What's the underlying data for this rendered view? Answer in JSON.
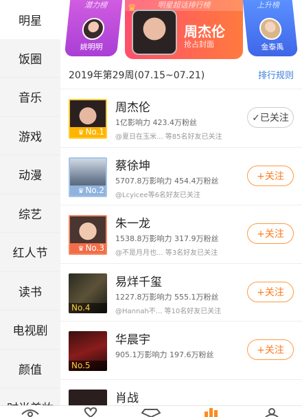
{
  "sidebar": {
    "items": [
      {
        "label": "明星",
        "active": true
      },
      {
        "label": "饭圈"
      },
      {
        "label": "音乐"
      },
      {
        "label": "游戏"
      },
      {
        "label": "动漫"
      },
      {
        "label": "综艺"
      },
      {
        "label": "红人节"
      },
      {
        "label": "读书"
      },
      {
        "label": "电视剧"
      },
      {
        "label": "颜值"
      },
      {
        "label": "时尚美妆"
      }
    ]
  },
  "banner": {
    "left": {
      "tag": "潜力榜",
      "name": "姚明明"
    },
    "center": {
      "tag": "明星超话排行榜",
      "name": "周杰伦",
      "sub": "抢占封面"
    },
    "right": {
      "tag": "上升榜",
      "name": "金泰禹"
    }
  },
  "header": {
    "week": "2019年第29周(07.15~07.21)",
    "rules_link": "排行规则"
  },
  "list": [
    {
      "name": "周杰伦",
      "stats": "1亿影响力 423.4万粉丝",
      "friends": "@夏日在玉米...  等85名好友已关注",
      "rank": "No.1",
      "follow": "✓已关注",
      "followed": true
    },
    {
      "name": "蔡徐坤",
      "stats": "5707.8万影响力 454.4万粉丝",
      "friends": "@Lcyicee等6名好友已关注",
      "rank": "No.2",
      "follow": "+关注",
      "followed": false
    },
    {
      "name": "朱一龙",
      "stats": "1538.8万影响力 317.9万粉丝",
      "friends": "@不是月月也...  等3名好友已关注",
      "rank": "No.3",
      "follow": "+关注",
      "followed": false
    },
    {
      "name": "易烊千玺",
      "stats": "1227.8万影响力 555.1万粉丝",
      "friends": "@Hannah不...  等10名好友已关注",
      "rank": "No.4",
      "follow": "+关注",
      "followed": false
    },
    {
      "name": "华晨宇",
      "stats": "905.1万影响力 197.6万粉丝",
      "friends": "",
      "rank": "No.5",
      "follow": "+关注",
      "followed": false
    },
    {
      "name": "肖战",
      "stats": "",
      "friends": "",
      "rank": "",
      "follow": "",
      "followed": false
    }
  ],
  "tabbar": {
    "icons": [
      "eye-icon",
      "heart-icon",
      "diamond-icon",
      "chart-icon",
      "profile-icon"
    ]
  },
  "colors": {
    "accent_orange": "#ff7a1a",
    "link_blue": "#3b7fd9",
    "gold": "#ffb400",
    "silver": "#8fb3dd",
    "bronze": "#f26d47"
  }
}
